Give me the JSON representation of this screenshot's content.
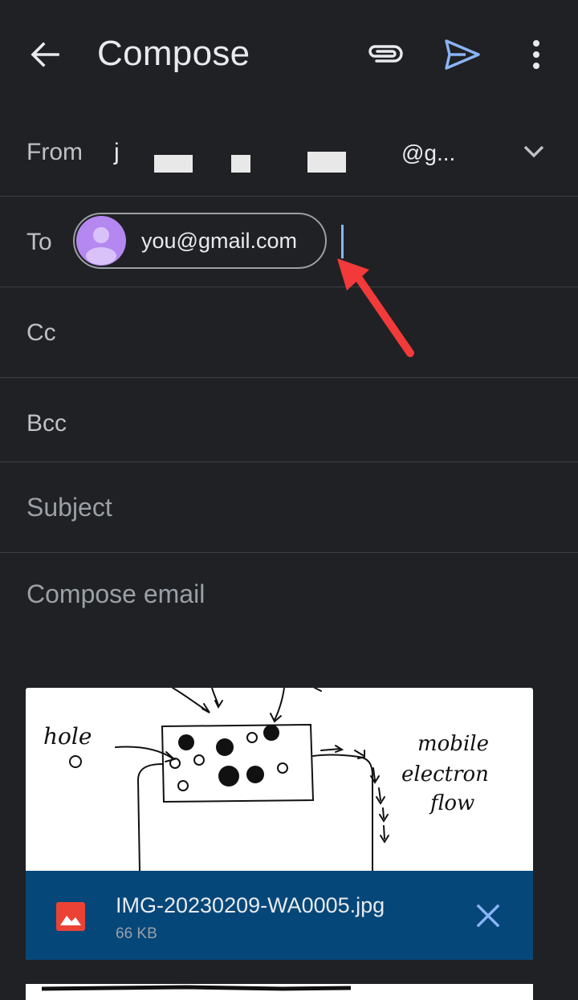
{
  "appbar": {
    "title": "Compose",
    "icons": [
      "back-arrow-icon",
      "paperclip-icon",
      "send-icon",
      "more-vert-icon"
    ],
    "send_color": "#8ab4f8"
  },
  "from": {
    "label": "From",
    "value_prefix": "j",
    "value_domain": "@g..."
  },
  "to": {
    "label": "To",
    "recipient": "you@gmail.com",
    "avatar_color": "#b587f1"
  },
  "cc": {
    "label": "Cc"
  },
  "bcc": {
    "label": "Bcc"
  },
  "subject": {
    "placeholder": "Subject"
  },
  "body": {
    "placeholder": "Compose email"
  },
  "attachment": {
    "filename": "IMG-20230209-WA0005.jpg",
    "size": "66 KB",
    "footer_color": "#064779",
    "preview_text": {
      "hole": "hole",
      "mobile": "mobile",
      "electron": "electron",
      "flow": "flow"
    }
  },
  "annotation": {
    "arrow_color": "#f23a3a"
  }
}
